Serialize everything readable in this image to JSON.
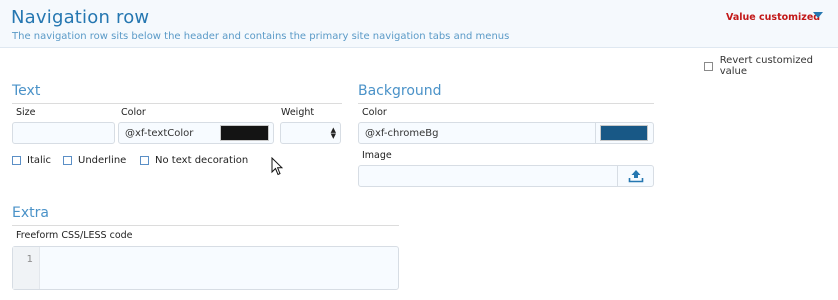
{
  "header": {
    "title": "Navigation row",
    "description": "The navigation row sits below the header and contains the primary site navigation tabs and menus",
    "status": "Value customized"
  },
  "revert": {
    "label": "Revert customized value",
    "checked": false
  },
  "text_section": {
    "title": "Text",
    "size_label": "Size",
    "size_value": "",
    "color_label": "Color",
    "color_value": "@xf-textColor",
    "color_swatch": "#141414",
    "weight_label": "Weight",
    "weight_value": "",
    "options": [
      {
        "label": "Italic",
        "checked": false
      },
      {
        "label": "Underline",
        "checked": false
      },
      {
        "label": "No text decoration",
        "checked": false
      }
    ]
  },
  "background_section": {
    "title": "Background",
    "color_label": "Color",
    "color_value": "@xf-chromeBg",
    "color_swatch": "#185886",
    "image_label": "Image",
    "image_value": "",
    "upload_icon": "upload-icon"
  },
  "extra_section": {
    "title": "Extra",
    "code_label": "Freeform CSS/LESS code",
    "line_number": "1",
    "code_value": ""
  },
  "colors": {
    "accent": "#2577b1",
    "status_red": "#c21818",
    "section_title": "#4a92c8"
  }
}
